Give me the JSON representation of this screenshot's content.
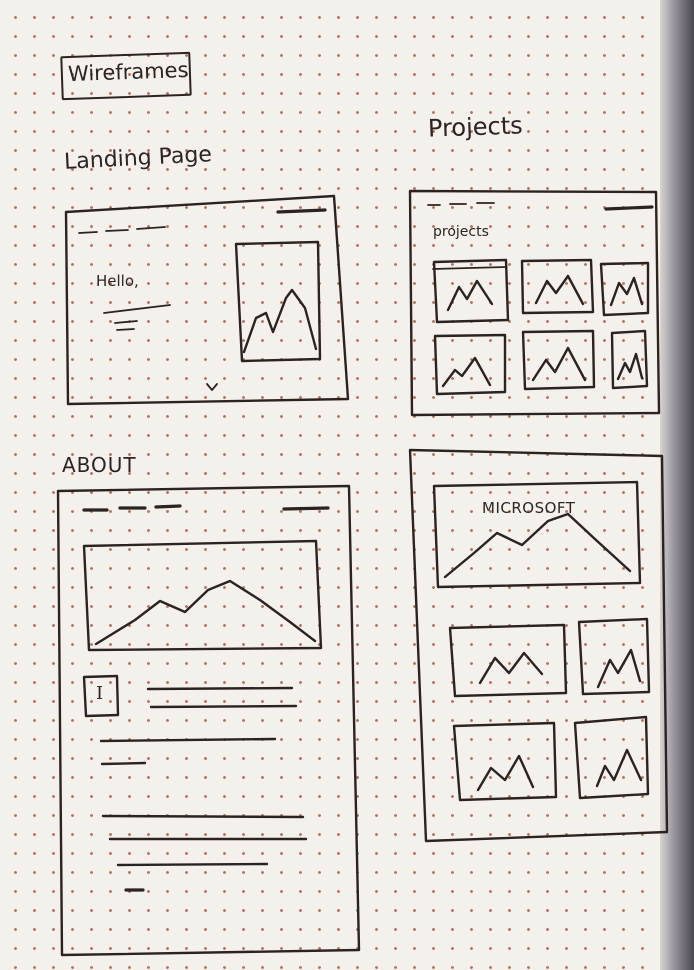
{
  "title": "Wireframes",
  "sections": {
    "landing": {
      "label": "Landing Page",
      "greeting": "Hello,"
    },
    "projects": {
      "label": "Projects",
      "inner_label": "projects"
    },
    "about": {
      "label": "ABOUT",
      "drop_cap": "I"
    },
    "project_detail": {
      "feature_label": "MICROSOFT"
    }
  }
}
